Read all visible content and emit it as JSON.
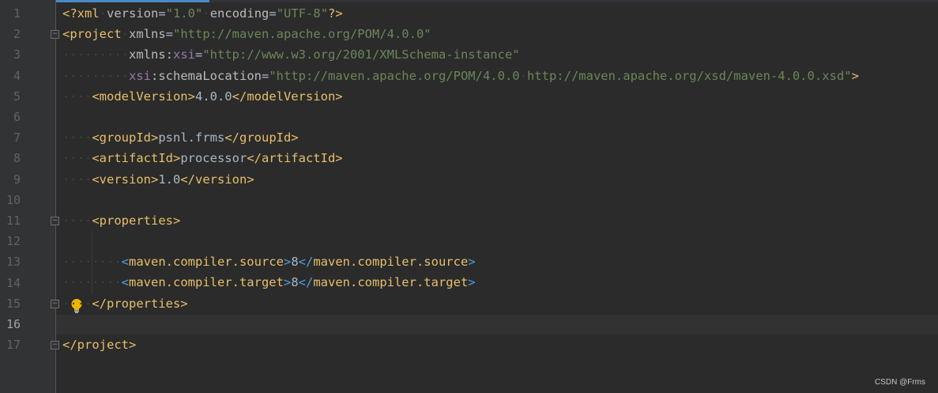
{
  "editor": {
    "line_numbers": [
      "1",
      "2",
      "3",
      "4",
      "5",
      "6",
      "7",
      "8",
      "9",
      "10",
      "11",
      "12",
      "13",
      "14",
      "15",
      "16",
      "17"
    ],
    "current_line": "16",
    "fold_marks": [
      "2",
      "11",
      "15",
      "17"
    ],
    "bulb_line": "15",
    "code_lines": [
      {
        "n": "1",
        "segs": [
          [
            "t",
            "<?"
          ],
          [
            "t",
            "xml"
          ],
          [
            "ws",
            "·"
          ],
          [
            "attr",
            "version"
          ],
          [
            "txt",
            "="
          ],
          [
            "str",
            "\"1.0\""
          ],
          [
            "ws",
            "·"
          ],
          [
            "attr",
            "encoding"
          ],
          [
            "txt",
            "="
          ],
          [
            "str",
            "\"UTF-8\""
          ],
          [
            "t",
            "?>"
          ]
        ]
      },
      {
        "n": "2",
        "segs": [
          [
            "t",
            "<project"
          ],
          [
            "ws",
            "·"
          ],
          [
            "attr",
            "xmlns"
          ],
          [
            "txt",
            "="
          ],
          [
            "str",
            "\"http://maven.apache.org/POM/4.0.0\""
          ]
        ]
      },
      {
        "n": "3",
        "segs": [
          [
            "ws",
            "·········"
          ],
          [
            "attr",
            "xmlns:"
          ],
          [
            "ns",
            "xsi"
          ],
          [
            "txt",
            "="
          ],
          [
            "str",
            "\"http://www.w3.org/2001/XMLSchema-instance\""
          ]
        ]
      },
      {
        "n": "4",
        "segs": [
          [
            "ws",
            "·········"
          ],
          [
            "ns",
            "xsi"
          ],
          [
            "attr",
            ":schemaLocation"
          ],
          [
            "txt",
            "="
          ],
          [
            "str",
            "\"http://maven.apache.org/POM/4.0.0"
          ],
          [
            "ws",
            "·"
          ],
          [
            "str",
            "http://maven.apache.org/xsd/maven-4.0.0.xsd\""
          ],
          [
            "t",
            ">"
          ]
        ]
      },
      {
        "n": "5",
        "segs": [
          [
            "ws",
            "····"
          ],
          [
            "t",
            "<modelVersion>"
          ],
          [
            "txt",
            "4.0.0"
          ],
          [
            "t",
            "</modelVersion>"
          ]
        ]
      },
      {
        "n": "6",
        "segs": []
      },
      {
        "n": "7",
        "segs": [
          [
            "ws",
            "····"
          ],
          [
            "t",
            "<groupId>"
          ],
          [
            "txt",
            "psnl.frms"
          ],
          [
            "t",
            "</groupId>"
          ]
        ]
      },
      {
        "n": "8",
        "segs": [
          [
            "ws",
            "····"
          ],
          [
            "t",
            "<artifactId>"
          ],
          [
            "txt",
            "processor"
          ],
          [
            "t",
            "</artifactId>"
          ]
        ]
      },
      {
        "n": "9",
        "segs": [
          [
            "ws",
            "····"
          ],
          [
            "t",
            "<version>"
          ],
          [
            "txt",
            "1.0"
          ],
          [
            "t",
            "</version>"
          ]
        ]
      },
      {
        "n": "10",
        "segs": []
      },
      {
        "n": "11",
        "segs": [
          [
            "ws",
            "····"
          ],
          [
            "t",
            "<properties>"
          ]
        ]
      },
      {
        "n": "12",
        "segs": []
      },
      {
        "n": "13",
        "segs": [
          [
            "ws",
            "········"
          ],
          [
            "t2",
            "<"
          ],
          [
            "t",
            "maven.compiler.source"
          ],
          [
            "t2",
            ">"
          ],
          [
            "txt",
            "8"
          ],
          [
            "t2",
            "</"
          ],
          [
            "t",
            "maven.compiler.source"
          ],
          [
            "t2",
            ">"
          ]
        ]
      },
      {
        "n": "14",
        "segs": [
          [
            "ws",
            "········"
          ],
          [
            "t2",
            "<"
          ],
          [
            "t",
            "maven.compiler.target"
          ],
          [
            "t2",
            ">"
          ],
          [
            "txt",
            "8"
          ],
          [
            "t2",
            "</"
          ],
          [
            "t",
            "maven.compiler.target"
          ],
          [
            "t2",
            ">"
          ]
        ]
      },
      {
        "n": "15",
        "segs": [
          [
            "ws",
            "····"
          ],
          [
            "t",
            "</properties>"
          ]
        ]
      },
      {
        "n": "16",
        "segs": []
      },
      {
        "n": "17",
        "segs": [
          [
            "t",
            "</project>"
          ]
        ]
      }
    ]
  },
  "icons": {
    "fold": "fold-marker-icon",
    "bulb": "lightbulb-icon"
  },
  "colors": {
    "background": "#2b2b2b",
    "gutter": "#313335",
    "tag": "#e8bf6a",
    "string": "#6a8759",
    "attribute": "#bababa",
    "namespace": "#9876aa",
    "text": "#a9b7c6",
    "bulb": "#f0b400"
  },
  "watermark": "CSDN @Frms"
}
